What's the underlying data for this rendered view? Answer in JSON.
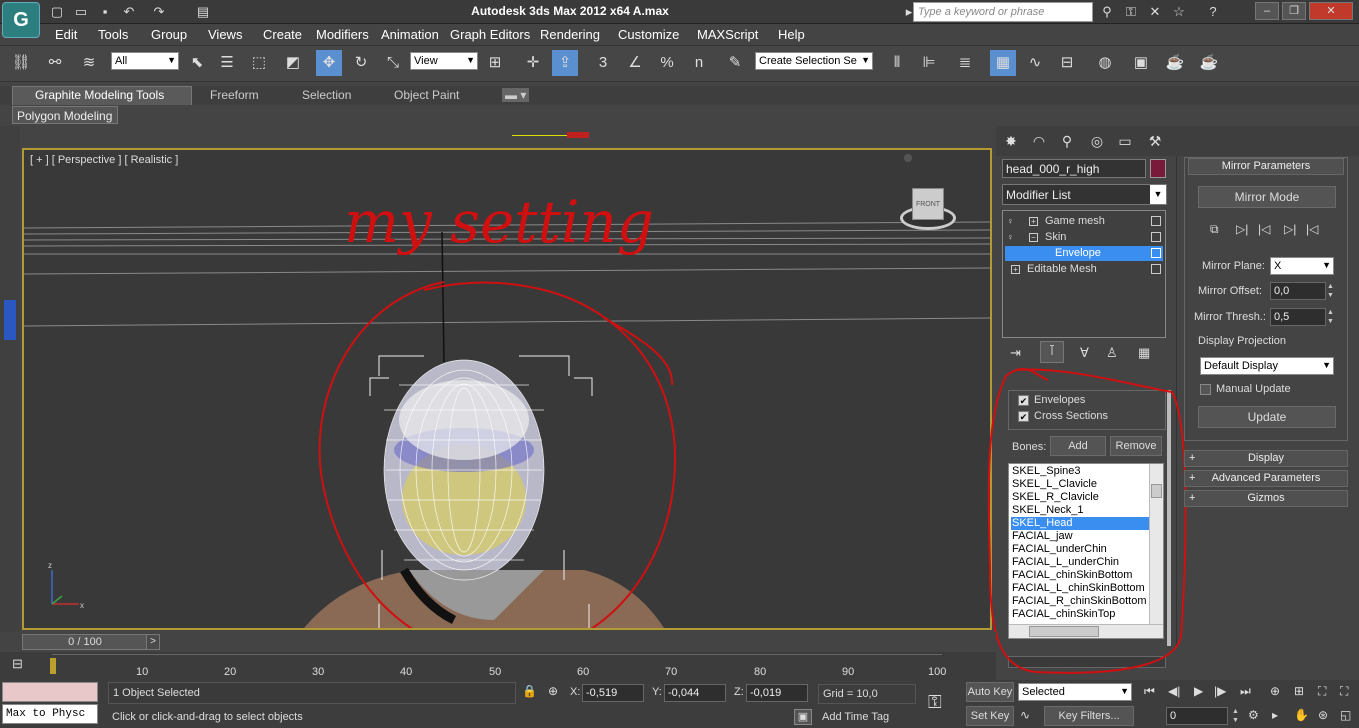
{
  "app": {
    "title": "Autodesk 3ds Max  2012 x64     A.max",
    "search_placeholder": "Type a keyword or phrase"
  },
  "menu": [
    "Edit",
    "Tools",
    "Group",
    "Views",
    "Create",
    "Modifiers",
    "Animation",
    "Graph Editors",
    "Rendering",
    "Customize",
    "MAXScript",
    "Help"
  ],
  "toolbar": {
    "filter": "All",
    "refcoord": "View",
    "selection_set": "Create Selection Se",
    "snap_3": "3",
    "snap_n": "n"
  },
  "ribbon": {
    "tabs": [
      "Graphite Modeling Tools",
      "Freeform",
      "Selection",
      "Object Paint"
    ],
    "panel": "Polygon Modeling"
  },
  "viewport": {
    "label": "[ + ] [ Perspective ] [ Realistic ]",
    "viewcube": "FRONT",
    "annotation": "my setting"
  },
  "cmd": {
    "object_name": "head_000_r_high",
    "modifier_list": "Modifier List",
    "stack": [
      {
        "label": "Game mesh",
        "sign": "+"
      },
      {
        "label": "Skin",
        "sign": "−"
      },
      {
        "label": "Envelope",
        "sign": ""
      },
      {
        "label": "Editable Mesh",
        "sign": "+"
      }
    ],
    "envelopes_label": "Envelopes",
    "cross_sections_label": "Cross Sections",
    "bones_label": "Bones:",
    "add_label": "Add",
    "remove_label": "Remove",
    "bones": [
      "SKEL_Spine3",
      "SKEL_L_Clavicle",
      "SKEL_R_Clavicle",
      "SKEL_Neck_1",
      "SKEL_Head",
      "FACIAL_jaw",
      "FACIAL_underChin",
      "FACIAL_L_underChin",
      "FACIAL_chinSkinBottom",
      "FACIAL_L_chinSkinBottom",
      "FACIAL_R_chinSkinBottom",
      "FACIAL_chinSkinTop"
    ],
    "selected_bone": "SKEL_Head"
  },
  "mirror": {
    "header": "Mirror Parameters",
    "mode_label": "Mirror Mode",
    "plane_label": "Mirror Plane:",
    "plane_value": "X",
    "offset_label": "Mirror Offset:",
    "offset_value": "0,0",
    "thresh_label": "Mirror Thresh.:",
    "thresh_value": "0,5",
    "proj_label": "Display Projection",
    "proj_value": "Default Display",
    "manual_label": "Manual Update",
    "update_label": "Update",
    "collapsed": [
      "Display",
      "Advanced Parameters",
      "Gizmos"
    ]
  },
  "timeline": {
    "frame": "0 / 100",
    "ticks": [
      "10",
      "20",
      "30",
      "40",
      "50",
      "60",
      "70",
      "80",
      "90",
      "100"
    ]
  },
  "status": {
    "script": "Max to Physc",
    "selected": "1 Object Selected",
    "prompt": "Click or click-and-drag to select objects",
    "x": "-0,519",
    "y": "-0,044",
    "z": "-0,019",
    "x_label": "X:",
    "y_label": "Y:",
    "z_label": "Z:",
    "grid": "Grid = 10,0",
    "add_time_tag": "Add Time Tag",
    "auto_key": "Auto Key",
    "set_key": "Set Key",
    "key_mode": "Selected",
    "key_filters": "Key Filters...",
    "frame_field": "0"
  },
  "colors": {
    "accent": "#3a8ef0",
    "viewport_border": "#b49a33",
    "annotation": "#d01010"
  }
}
